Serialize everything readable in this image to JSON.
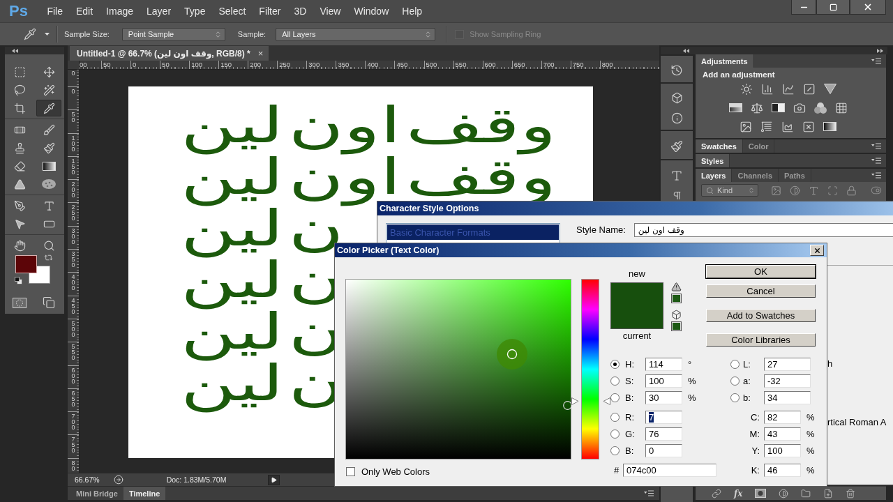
{
  "menu_bar": {
    "logo": "Ps",
    "items": [
      "File",
      "Edit",
      "Image",
      "Layer",
      "Type",
      "Select",
      "Filter",
      "3D",
      "View",
      "Window",
      "Help"
    ]
  },
  "options_bar": {
    "sample_size_label": "Sample Size:",
    "sample_size": "Point Sample",
    "sample_label": "Sample:",
    "sample": "All Layers",
    "sampling_ring": {
      "label": "Show Sampling Ring",
      "checked": false,
      "disabled": true
    }
  },
  "toolbox": {
    "tool_groups": [
      [
        {
          "kind": "marquee",
          "selected": false
        },
        {
          "kind": "move",
          "selected": false
        },
        {
          "kind": "lasso",
          "selected": false
        },
        {
          "kind": "wand",
          "selected": false
        },
        {
          "kind": "crop",
          "selected": false
        },
        {
          "kind": "eyedropper",
          "selected": true
        }
      ],
      [
        {
          "kind": "healing",
          "selected": false
        },
        {
          "kind": "brush",
          "selected": false
        },
        {
          "kind": "stamp",
          "selected": false
        },
        {
          "kind": "history",
          "selected": false
        },
        {
          "kind": "eraser",
          "selected": false
        },
        {
          "kind": "gradient",
          "selected": false
        },
        {
          "kind": "blur",
          "selected": false
        },
        {
          "kind": "sponge",
          "selected": false
        }
      ],
      [
        {
          "kind": "pen",
          "selected": false
        },
        {
          "kind": "type",
          "selected": false
        },
        {
          "kind": "path",
          "selected": false
        },
        {
          "kind": "rectangle",
          "selected": false
        }
      ],
      [
        {
          "kind": "hand",
          "selected": false
        },
        {
          "kind": "zoom",
          "selected": false
        }
      ]
    ],
    "color_swatches": [
      {
        "kind": "background",
        "color": "#ffffff"
      },
      {
        "kind": "foreground",
        "color": "#5c0508"
      }
    ]
  },
  "document": {
    "tab": {
      "title": "Untitled-1 @ 66.7% (وقف اون لين, RGB/8) *",
      "close": "×"
    },
    "h_ruler": [
      "00",
      "50",
      "0",
      "50",
      "100",
      "150",
      "200",
      "250",
      "300",
      "350",
      "400",
      "450",
      "500",
      "550",
      "600",
      "650",
      "700",
      "750",
      "800"
    ],
    "v_ruler": [
      "0",
      "0",
      "50",
      "100",
      "150",
      "200",
      "250",
      "300",
      "350",
      "400",
      "450",
      "500",
      "550",
      "600",
      "650",
      "700",
      "750",
      "80"
    ],
    "canvas_lines": [
      "وقف اون لين",
      "وقف اون لين",
      "ن لين",
      "ن لين",
      "ن لين",
      "ن لين"
    ],
    "status": {
      "zoom": "66.67%",
      "doc_size": "Doc: 1.83M/5.70M"
    }
  },
  "bottom_tabs": [
    {
      "label": "Mini Bridge",
      "selected": false
    },
    {
      "label": "Timeline",
      "selected": true
    }
  ],
  "panels": [
    {
      "kind": "adjustments",
      "tabs": [
        {
          "label": "Adjustments",
          "selected": true
        }
      ],
      "heading": "Add an adjustment"
    },
    {
      "kind": "collapsed",
      "tabs": [
        {
          "label": "Swatches",
          "selected": true
        },
        {
          "label": "Color",
          "selected": false
        }
      ]
    },
    {
      "kind": "collapsed",
      "tabs": [
        {
          "label": "Styles",
          "selected": true
        }
      ]
    },
    {
      "kind": "layers",
      "tabs": [
        {
          "label": "Layers",
          "selected": true
        },
        {
          "label": "Channels",
          "selected": false
        },
        {
          "label": "Paths",
          "selected": false
        }
      ],
      "filter": "Kind"
    }
  ],
  "layers_footer": {
    "effects": "fx"
  },
  "character_style_dialog": {
    "title": "Character Style Options",
    "categories": [
      {
        "label": "Basic Character Formats",
        "selected": true
      }
    ],
    "style_name_label": "Style Name:",
    "style_name": "وقف اون لين",
    "cut_labels": [
      "h",
      "rtical Roman A"
    ]
  },
  "color_picker": {
    "title": "Color Picker (Text Color)",
    "new_label": "new",
    "current_label": "current",
    "hue_slider": {
      "level": 0.32
    },
    "buttons": [
      {
        "label": "OK",
        "default": true
      },
      {
        "label": "Cancel",
        "default": false
      },
      {
        "label": "Add to Swatches",
        "default": false
      },
      {
        "label": "Color Libraries",
        "default": false
      }
    ],
    "left_fields": [
      {
        "kind": "radio",
        "label": "H:",
        "value": "114",
        "unit": "°",
        "selected": true,
        "highlighted": false
      },
      {
        "kind": "radio",
        "label": "S:",
        "value": "100",
        "unit": "%",
        "selected": false,
        "highlighted": false
      },
      {
        "kind": "radio",
        "label": "B:",
        "value": "30",
        "unit": "%",
        "selected": false,
        "highlighted": false
      },
      {
        "kind": "radio",
        "label": "R:",
        "value": "7",
        "selected": false,
        "highlighted": true
      },
      {
        "kind": "radio",
        "label": "G:",
        "value": "76",
        "selected": false,
        "highlighted": false
      },
      {
        "kind": "radio",
        "label": "B:",
        "value": "0",
        "selected": false,
        "highlighted": false
      }
    ],
    "hex": {
      "label": "#",
      "value": "074c00"
    },
    "right_fields": [
      {
        "kind": "radio",
        "label": "L:",
        "value": "27",
        "selected": false,
        "highlighted": false
      },
      {
        "kind": "radio",
        "label": "a:",
        "value": "-32",
        "selected": false,
        "highlighted": false
      },
      {
        "kind": "radio",
        "label": "b:",
        "value": "34",
        "selected": false,
        "highlighted": false
      },
      {
        "kind": "plain",
        "label": "C:",
        "value": "82",
        "unit": "%",
        "highlighted": false
      },
      {
        "kind": "plain",
        "label": "M:",
        "value": "43",
        "unit": "%",
        "highlighted": false
      },
      {
        "kind": "plain",
        "label": "Y:",
        "value": "100",
        "unit": "%",
        "highlighted": false
      },
      {
        "kind": "plain",
        "label": "K:",
        "value": "46",
        "unit": "%",
        "highlighted": false
      }
    ],
    "web_colors": {
      "label": "Only Web Colors",
      "checked": false
    }
  }
}
